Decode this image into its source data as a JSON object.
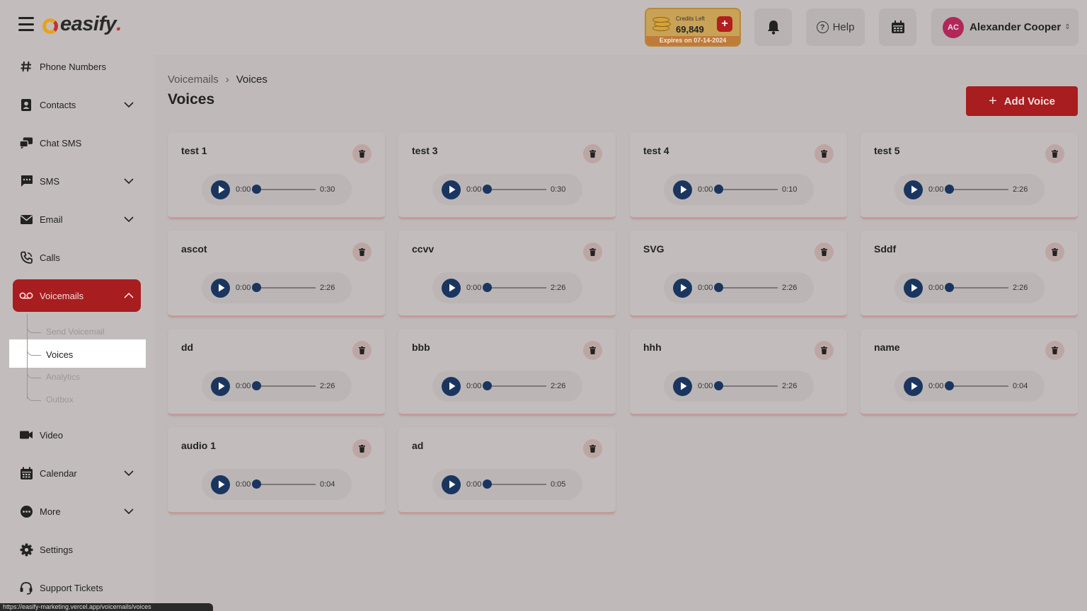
{
  "app": {
    "logo_text": "easify",
    "logo_dot": "."
  },
  "header": {
    "credits": {
      "label": "Credits Left",
      "value": "69,849",
      "expires": "Expires on 07-14-2024",
      "add_label": "+"
    },
    "help_label": "Help",
    "user": {
      "initials": "AC",
      "name": "Alexander Cooper"
    }
  },
  "sidebar": {
    "items": [
      {
        "label": "Phone Numbers",
        "icon": "hash-icon",
        "has_chevron": false
      },
      {
        "label": "Contacts",
        "icon": "contact-book-icon",
        "has_chevron": true
      },
      {
        "label": "Chat SMS",
        "icon": "chat-bubbles-icon",
        "has_chevron": false
      },
      {
        "label": "SMS",
        "icon": "message-icon",
        "has_chevron": true
      },
      {
        "label": "Email",
        "icon": "envelope-icon",
        "has_chevron": true
      },
      {
        "label": "Calls",
        "icon": "phone-icon",
        "has_chevron": false
      },
      {
        "label": "Voicemails",
        "icon": "voicemail-icon",
        "has_chevron": true,
        "active": true
      },
      {
        "label": "Video",
        "icon": "video-camera-icon",
        "has_chevron": false
      },
      {
        "label": "Calendar",
        "icon": "calendar-icon",
        "has_chevron": true
      },
      {
        "label": "More",
        "icon": "more-dots-icon",
        "has_chevron": true
      },
      {
        "label": "Settings",
        "icon": "gear-icon",
        "has_chevron": false
      },
      {
        "label": "Support Tickets",
        "icon": "headset-icon",
        "has_chevron": false
      }
    ],
    "voicemail_sub": [
      "Send Voicemail",
      "Voices",
      "Analytics",
      "Outbox"
    ],
    "active_sub": "Voices"
  },
  "status_url": "https://easify-marketing.vercel.app/voicemails/voices",
  "breadcrumb": {
    "parent": "Voicemails",
    "separator": "›",
    "current": "Voices"
  },
  "page_title": "Voices",
  "add_voice_label": "Add Voice",
  "voices": [
    {
      "name": "test 1",
      "current": "0:00",
      "duration": "0:30"
    },
    {
      "name": "test 3",
      "current": "0:00",
      "duration": "0:30"
    },
    {
      "name": "test 4",
      "current": "0:00",
      "duration": "0:10"
    },
    {
      "name": "test 5",
      "current": "0:00",
      "duration": "2:26"
    },
    {
      "name": "ascot",
      "current": "0:00",
      "duration": "2:26"
    },
    {
      "name": "ccvv",
      "current": "0:00",
      "duration": "2:26"
    },
    {
      "name": "SVG",
      "current": "0:00",
      "duration": "2:26"
    },
    {
      "name": "Sddf",
      "current": "0:00",
      "duration": "2:26"
    },
    {
      "name": "dd",
      "current": "0:00",
      "duration": "2:26"
    },
    {
      "name": "bbb",
      "current": "0:00",
      "duration": "2:26"
    },
    {
      "name": "hhh",
      "current": "0:00",
      "duration": "2:26"
    },
    {
      "name": "name",
      "current": "0:00",
      "duration": "0:04"
    },
    {
      "name": "audio 1",
      "current": "0:00",
      "duration": "0:04"
    },
    {
      "name": "ad",
      "current": "0:00",
      "duration": "0:05"
    }
  ],
  "colors": {
    "accent": "#a81d1f",
    "player": "#1a3660",
    "credits": "#c8a257"
  }
}
